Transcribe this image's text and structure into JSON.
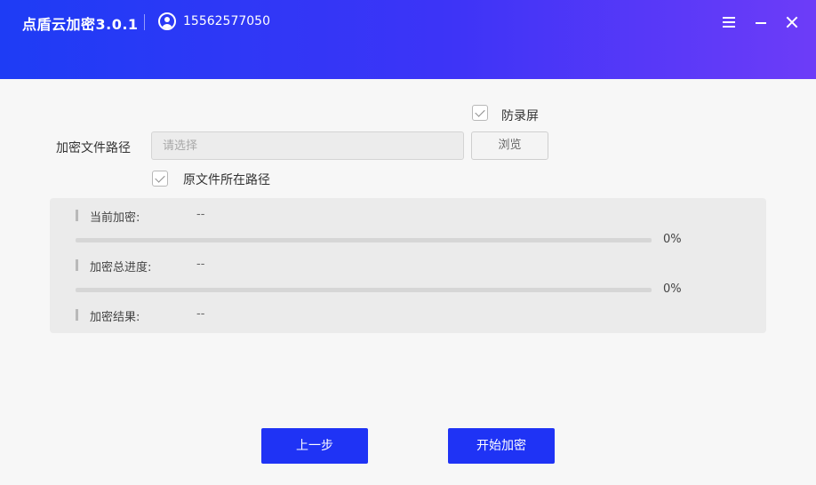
{
  "app": {
    "title": "点盾云加密3.0.1",
    "phone": "15562577050"
  },
  "colors": {
    "brand": "#1f33f5",
    "header_start": "#1e3cf5",
    "header_end": "#6d3cf8"
  },
  "icons": {
    "menu": "menu-icon",
    "minimize": "minimize-icon",
    "close": "close-icon",
    "user": "user-icon"
  },
  "options": {
    "anti_record_label": "防录屏",
    "anti_record_checked": true,
    "original_path_label": "原文件所在路径",
    "original_path_checked": true
  },
  "file_path": {
    "label": "加密文件路径",
    "value": "",
    "placeholder": "请选择",
    "browse_label": "浏览"
  },
  "progress": {
    "current_label": "当前加密:",
    "current_value": "--",
    "current_percent": "0%",
    "current_fraction": 0,
    "total_label": "加密总进度:",
    "total_value": "--",
    "total_percent": "0%",
    "total_fraction": 0,
    "result_label": "加密结果:",
    "result_value": "--"
  },
  "buttons": {
    "prev": "上一步",
    "start": "开始加密"
  }
}
